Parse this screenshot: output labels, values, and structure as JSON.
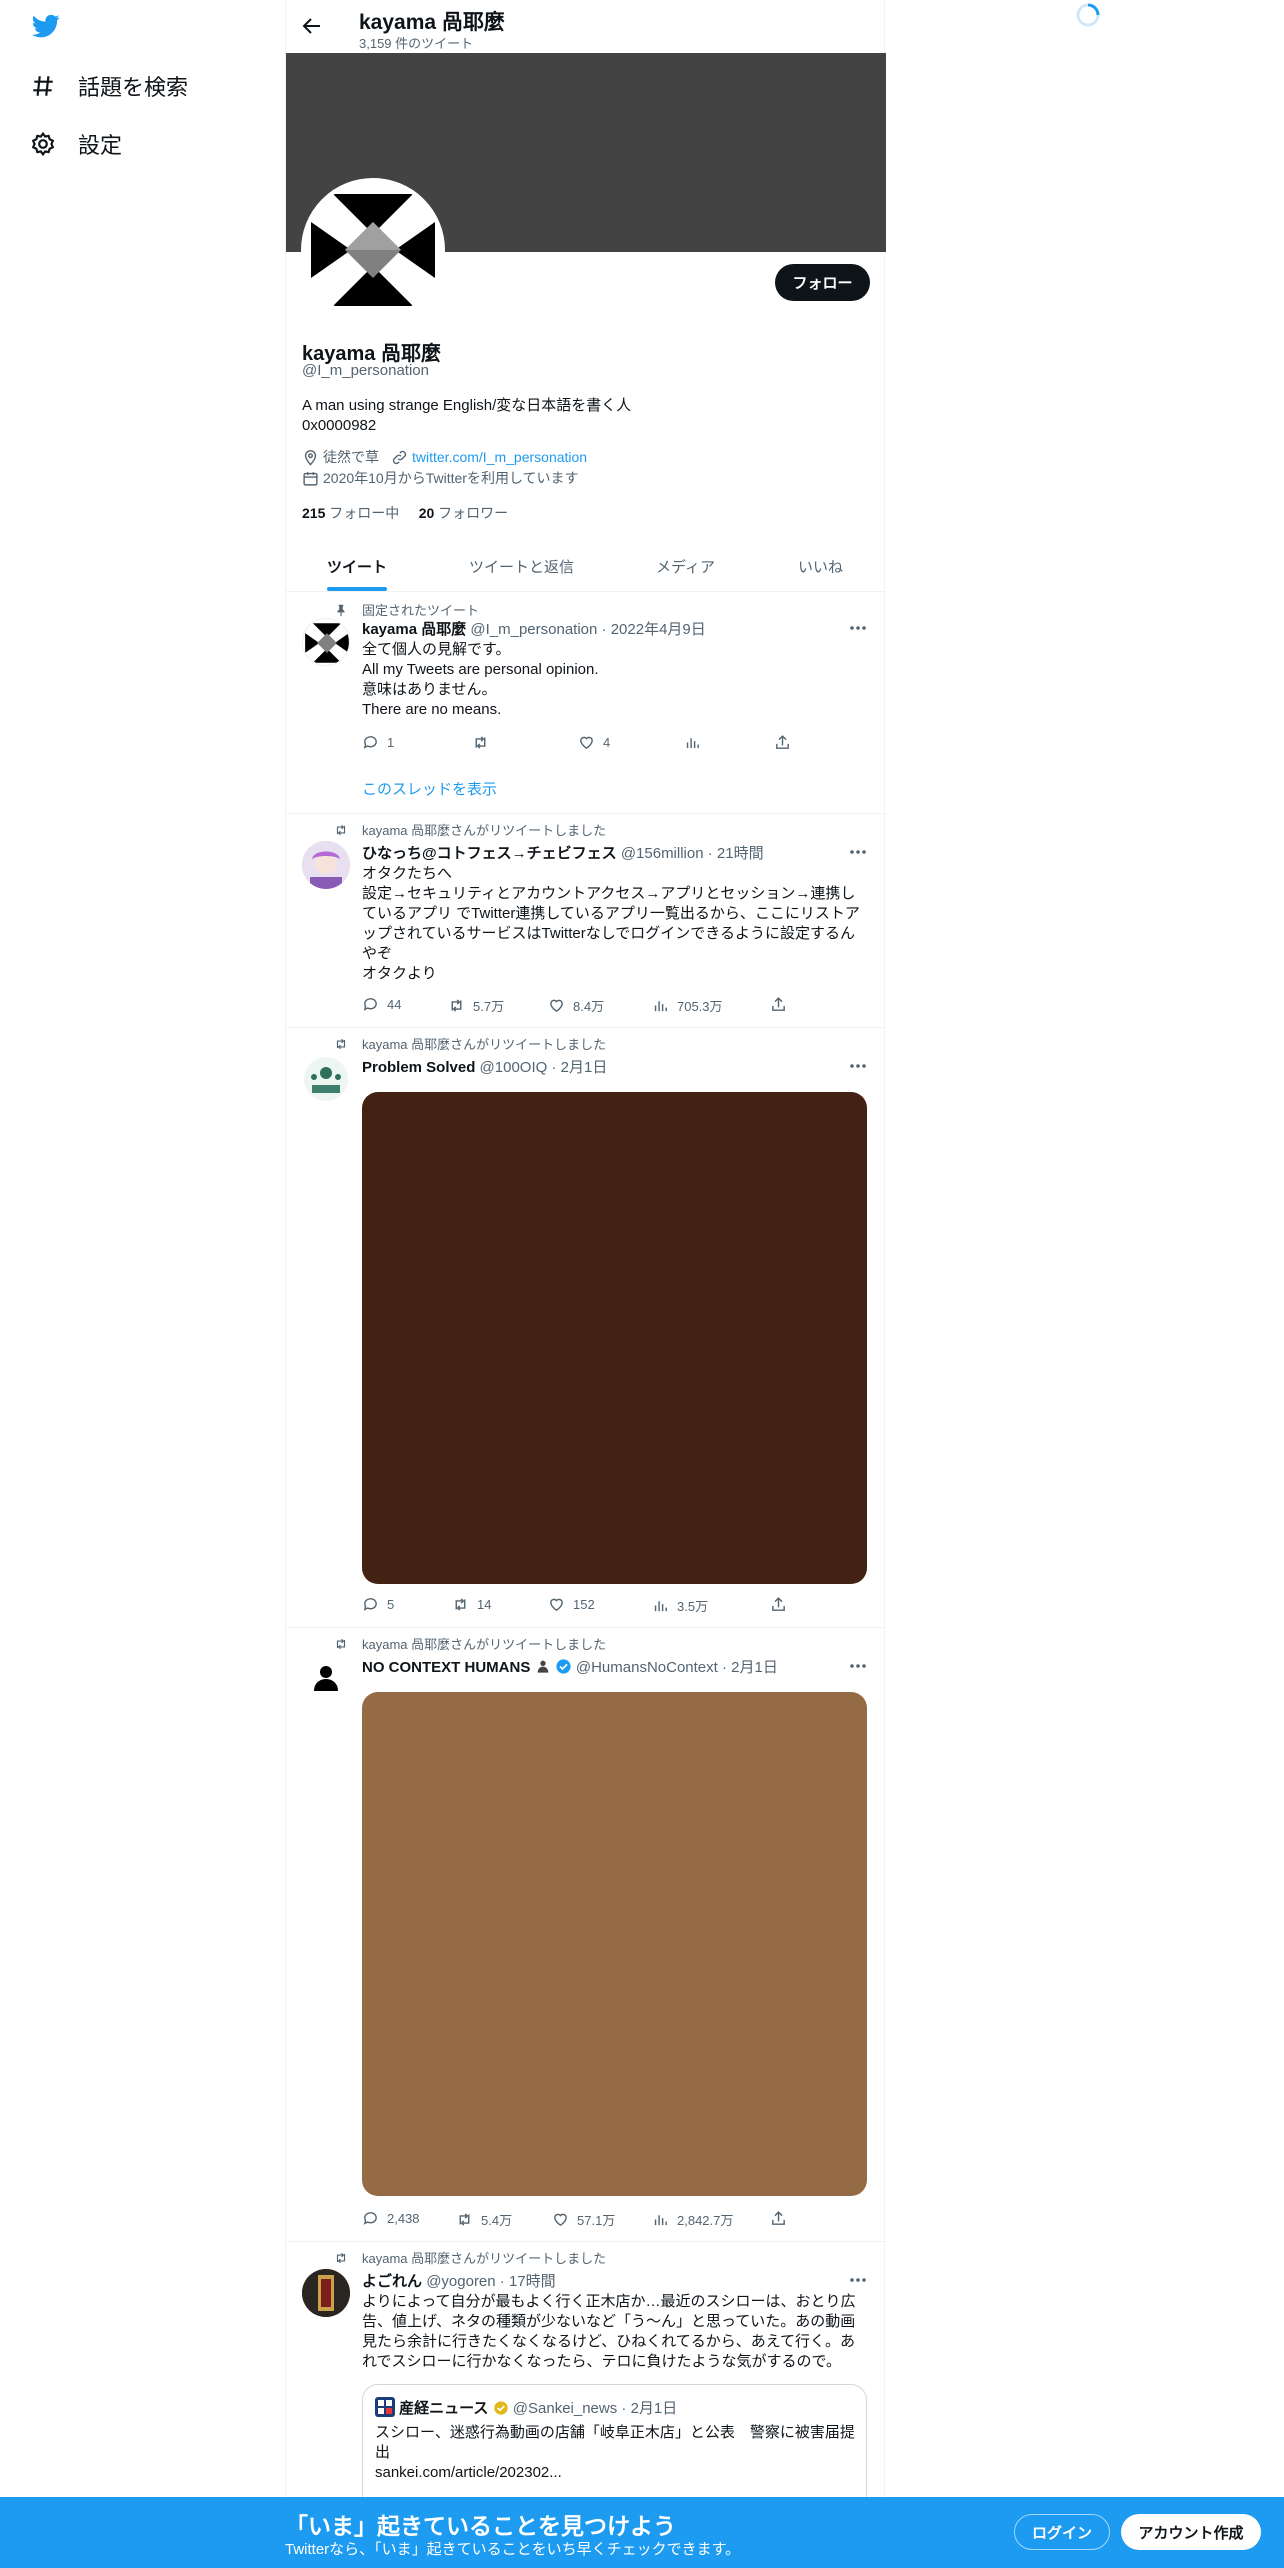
{
  "nav": {
    "explore_label": "話題を検索",
    "settings_label": "設定"
  },
  "header": {
    "title": "kayama 咼耶麼",
    "tweet_count": "3,159 件のツイート"
  },
  "profile": {
    "name": "kayama 咼耶麼",
    "handle": "@I_m_personation",
    "follow_label": "フォロー",
    "bio_line1": "A man using strange English/変な日本語を書く人",
    "bio_line2": "0x0000982",
    "location": "徒然で草",
    "website": "twitter.com/I_m_personation",
    "joined": "2020年10月からTwitterを利用しています",
    "following_count": "215",
    "following_label": "フォロー中",
    "followers_count": "20",
    "followers_label": "フォロワー"
  },
  "tabs": [
    {
      "label": "ツイート",
      "active": true
    },
    {
      "label": "ツイートと返信",
      "active": false
    },
    {
      "label": "メディア",
      "active": false
    },
    {
      "label": "いいね",
      "active": false
    }
  ],
  "tweets": [
    {
      "context": "固定されたツイート",
      "name": "kayama 咼耶麼",
      "handle": "@I_m_personation",
      "time": "· 2022年4月9日",
      "text_lines": [
        "全て個人の見解です。",
        "All my  Tweets are personal opinion.",
        "意味はありません。",
        "There are no means."
      ],
      "replies": "1",
      "retweets": "",
      "likes": "4",
      "views": "",
      "show_thread": "このスレッドを表示"
    },
    {
      "context": "kayama 咼耶麼さんがリツイートしました",
      "name": "ひなっち@コトフェス→チェビフェス",
      "handle": "@156million",
      "time": "· 21時間",
      "text_lines": [
        "オタクたちへ",
        "設定→セキュリティとアカウントアクセス→アプリとセッション→連携し",
        "ているアプリ でTwitter連携しているアプリ一覧出るから、ここにリストア",
        "ップされているサービスはTwitterなしでログインできるように設定するん",
        "やぞ",
        "オタクより"
      ],
      "replies": "44",
      "retweets": "5.7万",
      "likes": "8.4万",
      "views": "705.3万"
    },
    {
      "context": "kayama 咼耶麼さんがリツイートしました",
      "name": "Problem Solved",
      "handle": "@100OIQ",
      "time": "· 2月1日",
      "media_color": "#432213",
      "replies": "5",
      "retweets": "14",
      "likes": "152",
      "views": "3.5万"
    },
    {
      "context": "kayama 咼耶麼さんがリツイートしました",
      "name": "NO CONTEXT HUMANS",
      "handle": "@HumansNoContext",
      "time": "· 2月1日",
      "media_color": "#946b45",
      "replies": "2,438",
      "retweets": "5.4万",
      "likes": "57.1万",
      "views": "2,842.7万"
    },
    {
      "context": "kayama 咼耶麼さんがリツイートしました",
      "name": "よごれん",
      "handle": "@yogoren",
      "time": "· 17時間",
      "text_lines": [
        "よりによって自分が最もよく行く正木店か…最近のスシローは、おとり広",
        "告、値上げ、ネタの種類が少ないなど「う〜ん」と思っていた。あの動画",
        "見たら余計に行きたくなくなるけど、ひねくれてるから、あえて行く。あ",
        "れでスシローに行かなくなったら、テロに負けたような気がするので。"
      ],
      "quote": {
        "name": "産経ニュース",
        "handle": "@Sankei_news",
        "time": "· 2月1日",
        "text_lines": [
          "スシロー、迷惑行為動画の店舗「岐阜正木店」と公表　警察に被害届提",
          "出"
        ],
        "link": "sankei.com/article/202302..."
      }
    }
  ],
  "bottom_bar": {
    "title": "「いま」起きていることを見つけよう",
    "subtitle": "Twitterなら、「いま」起きていることをいち早くチェックできます。",
    "login_label": "ログイン",
    "signup_label": "アカウント作成"
  },
  "colors": {
    "brand": "#1d9bf0",
    "banner": "#434343",
    "text_secondary": "#536471"
  }
}
